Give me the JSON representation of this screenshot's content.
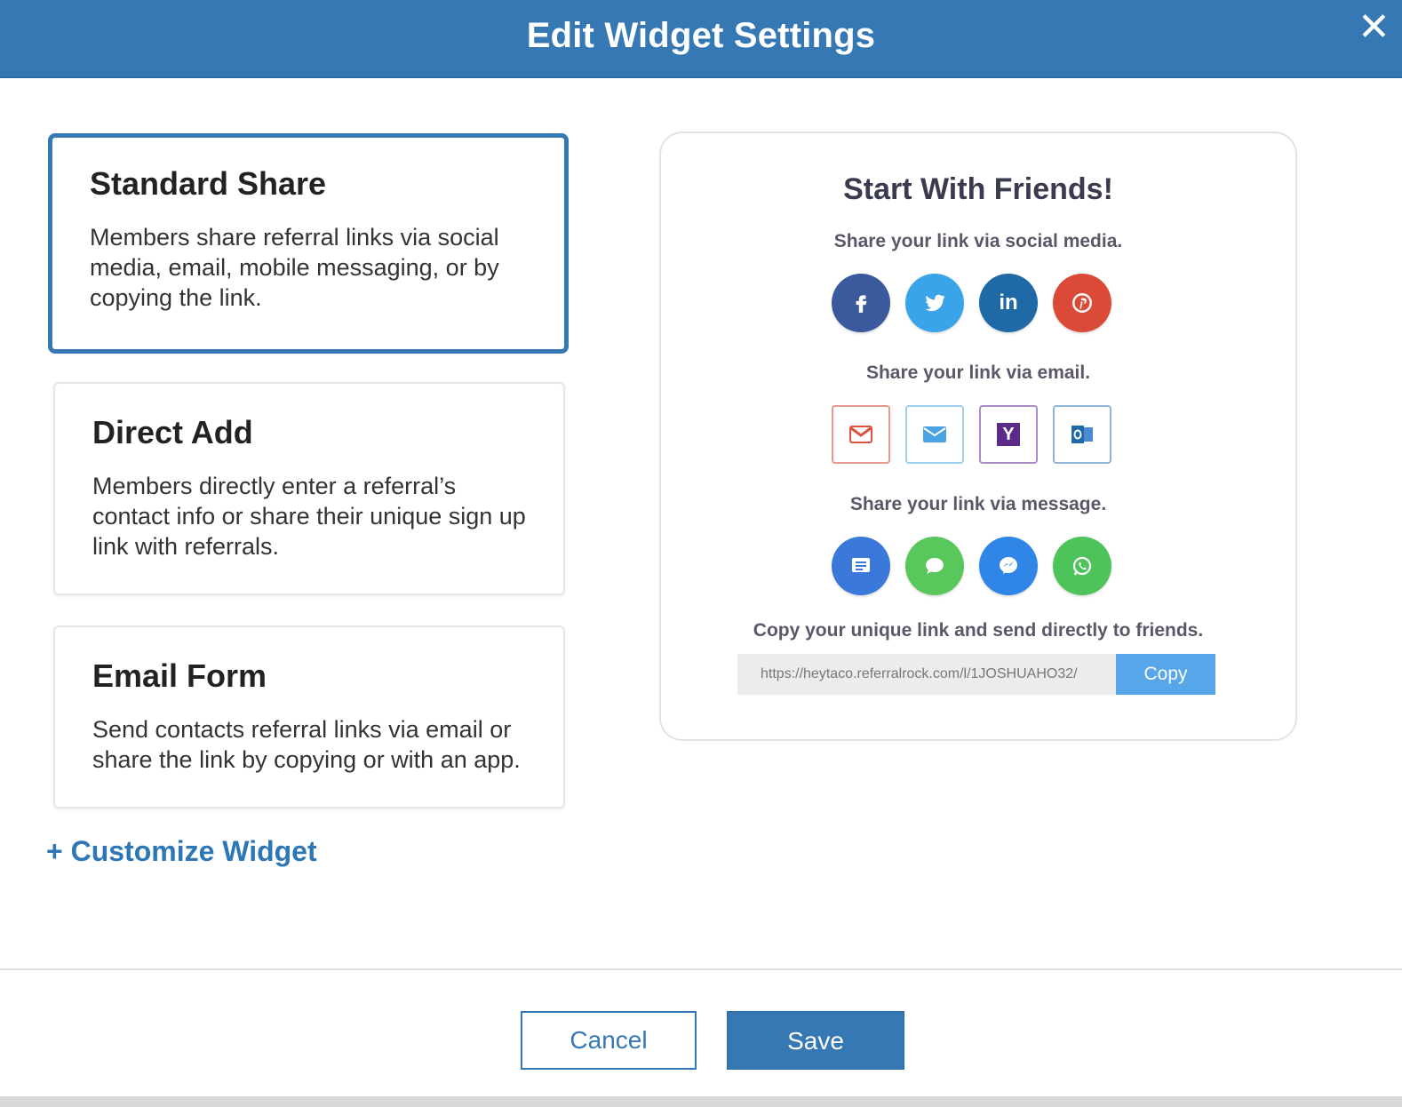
{
  "dialog": {
    "title": "Edit Widget Settings",
    "close_label": "✕"
  },
  "options": [
    {
      "title": "Standard Share",
      "description": "Members share referral links via social media, email, mobile messaging, or by copying the link.",
      "selected": true
    },
    {
      "title": "Direct Add",
      "description": "Members directly enter a referral’s contact info or share their unique sign up link with referrals.",
      "selected": false
    },
    {
      "title": "Email Form",
      "description": "Send contacts referral links via email or share the link by copying or with an app.",
      "selected": false
    }
  ],
  "customize_label": "+ Customize Widget",
  "preview": {
    "title": "Start With Friends!",
    "social_label": "Share your link via social media.",
    "email_label": "Share your link via email.",
    "message_label": "Share your link via message.",
    "copy_label": "Copy your unique link and send directly to friends.",
    "link": "https://heytaco.referralrock.com/l/1JOSHUAHO32/",
    "copy_button": "Copy",
    "social_icons": [
      {
        "name": "facebook-icon",
        "glyph": "f",
        "color": "#3b5a9e"
      },
      {
        "name": "twitter-icon",
        "glyph": "t",
        "color": "#3aa4e8"
      },
      {
        "name": "linkedin-icon",
        "glyph": "in",
        "color": "#1f6aa6"
      },
      {
        "name": "pinterest-icon",
        "glyph": "p",
        "color": "#db4a37"
      }
    ],
    "email_icons": [
      {
        "name": "gmail-icon",
        "glyph": "M",
        "color": "#d9533f"
      },
      {
        "name": "mail-icon",
        "glyph": "✉",
        "color": "#4aa3e3"
      },
      {
        "name": "yahoo-icon",
        "glyph": "Y",
        "color": "#5b2a8a"
      },
      {
        "name": "outlook-icon",
        "glyph": "O",
        "color": "#1f6aa6"
      }
    ],
    "message_icons": [
      {
        "name": "sms-icon",
        "glyph": "▤",
        "color": "#3a78d9"
      },
      {
        "name": "imessage-icon",
        "glyph": "●",
        "color": "#58c75c"
      },
      {
        "name": "messenger-icon",
        "glyph": "~",
        "color": "#2f86e6"
      },
      {
        "name": "whatsapp-icon",
        "glyph": "✆",
        "color": "#4ec35a"
      }
    ]
  },
  "footer": {
    "cancel_label": "Cancel",
    "save_label": "Save"
  }
}
